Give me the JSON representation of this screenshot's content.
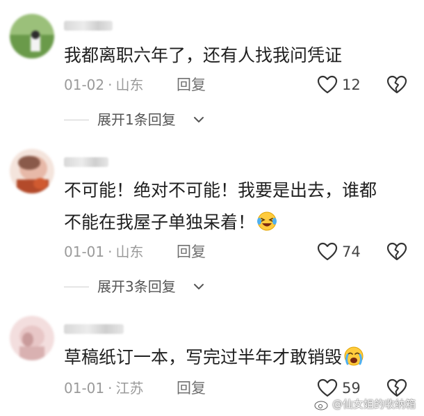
{
  "comments": [
    {
      "text_lines": [
        "我都离职六年了，还有人找我问凭证"
      ],
      "date": "01-02",
      "location": "山东",
      "reply_label": "回复",
      "likes": "12",
      "expand_label": "展开1条回复",
      "avatar_colors": [
        "#6a9a4a",
        "#9bc07a",
        "#d9e6cf"
      ]
    },
    {
      "text_lines": [
        "不可能！绝对不可能！我要是出去，谁都",
        "不能在我屋子单独呆着！"
      ],
      "emoji_after_line": 1,
      "emoji_icon": "laughing-crying-emoji",
      "date": "01-01",
      "location": "山东",
      "reply_label": "回复",
      "likes": "74",
      "expand_label": "展开3条回复",
      "avatar_colors": [
        "#c98a7a",
        "#e7b9a8",
        "#b34a2a"
      ]
    },
    {
      "text_lines": [
        "草稿纸订一本，写完过半年才敢销毁"
      ],
      "emoji_after_line": 0,
      "emoji_icon": "crying-emoji",
      "date": "01-01",
      "location": "江苏",
      "reply_label": "回复",
      "likes": "59",
      "avatar_colors": [
        "#e8c7c7",
        "#f3dede",
        "#c99b9b"
      ]
    }
  ],
  "meta_separator": "·",
  "icons": {
    "like": "heart-outline-icon",
    "dislike": "broken-heart-icon",
    "expand": "chevron-down-icon",
    "watermark": "weibo-icon"
  },
  "watermark": "@仙女姐的收纳箱"
}
